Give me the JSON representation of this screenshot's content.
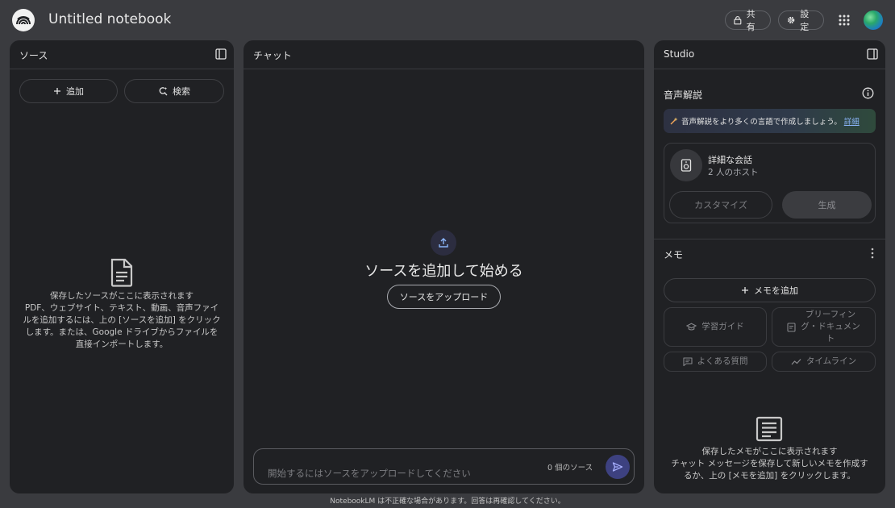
{
  "header": {
    "title": "Untitled notebook",
    "share_label": "共有",
    "settings_label": "設定"
  },
  "sources": {
    "title": "ソース",
    "add_label": "追加",
    "search_label": "検索",
    "empty_lines": [
      "保存したソースがここに表示されます",
      "PDF、ウェブサイト、テキスト、動画、音声ファイ",
      "ルを追加するには、上の [ソースを追加] をクリック",
      "します。または、Google ドライブからファイルを",
      "直接インポートします。"
    ]
  },
  "chat": {
    "title": "チャット",
    "hero": "ソースを追加して始める",
    "upload_label": "ソースをアップロード",
    "input_placeholder": "開始するにはソースをアップロードしてください",
    "source_count": "0 個のソース"
  },
  "studio": {
    "title": "Studio",
    "audio_title": "音声解説",
    "banner_text": "音声解説をより多くの言語で作成しましょう。",
    "banner_link": "詳細",
    "card_title": "詳細な会話",
    "card_subtitle": "2 人のホスト",
    "customize_label": "カスタマイズ",
    "generate_label": "生成",
    "memo_title": "メモ",
    "add_memo_label": "メモを追加",
    "chip_study_guide": "学習ガイド",
    "chip_briefing_lines": [
      "ブリーフィン",
      "グ・ドキュメン",
      "ト"
    ],
    "chip_faq": "よくある質問",
    "chip_timeline": "タイムライン",
    "memo_empty_lines": [
      "保存したメモがここに表示されます",
      "チャット メッセージを保存して新しいメモを作成す",
      "るか、上の [メモを追加] をクリックします。"
    ]
  },
  "footer": {
    "text": "NotebookLM は不正確な場合があります。回答は再確認してください。"
  },
  "colors": {
    "background": "#3a3b3f",
    "panel": "#202124",
    "send_button": "#3d4180",
    "link": "#8ab4f8"
  },
  "icons": [
    "notebooklm-logo-icon",
    "lock-icon",
    "gear-icon",
    "apps-grid-icon",
    "panel-toggle-icon",
    "plus-icon",
    "discover-search-icon",
    "document-icon",
    "upload-icon",
    "send-icon",
    "info-icon",
    "sparkle-icon",
    "speaker-icon",
    "more-vert-icon",
    "school-icon",
    "briefing-doc-icon",
    "faq-chat-icon",
    "timeline-icon",
    "note-icon"
  ]
}
